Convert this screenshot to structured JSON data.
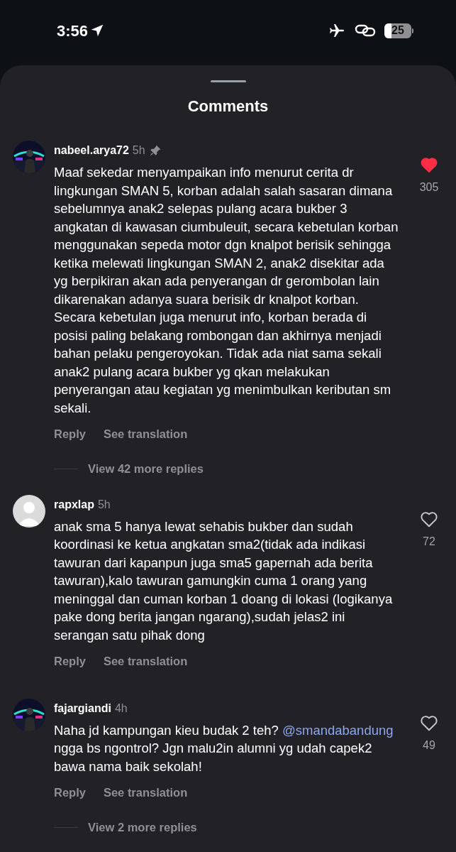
{
  "status_bar": {
    "time": "3:56",
    "battery_text": "25"
  },
  "sheet": {
    "title": "Comments"
  },
  "comments": [
    {
      "username": "nabeel.arya72",
      "age": "5h",
      "pinned": true,
      "liked": true,
      "likes": "305",
      "body": [
        {
          "kind": "text",
          "text": "Maaf sekedar menyampaikan info menurut cerita dr lingkungan SMAN 5, korban adalah salah sasaran dimana sebelumnya anak2 selepas pulang acara bukber 3 angkatan di kawasan ciumbuleuit, secara kebetulan korban menggunakan sepeda motor dgn knalpot berisik sehingga ketika melewati lingkungan SMAN 2, anak2 disekitar ada yg berpikiran akan ada penyerangan dr gerombolan lain dikarenakan adanya suara berisik dr knalpot korban. Secara kebetulan juga menurut info, korban berada di posisi paling belakang rombongan dan akhirnya menjadi bahan pelaku pengeroyokan. Tidak ada niat sama sekali anak2 pulang acara bukber yg qkan melakukan penyerangan atau kegiatan yg menimbulkan keributan sm sekali."
        }
      ],
      "reply": "Reply",
      "translate": "See translation",
      "more_replies": "View 42 more replies"
    },
    {
      "avatar": {
        "kind": "default"
      },
      "username": "rapxlap",
      "age": "5h",
      "pinned": false,
      "liked": false,
      "likes": "72",
      "body": [
        {
          "kind": "text",
          "text": "anak sma 5 hanya lewat sehabis bukber dan sudah koordinasi ke ketua angkatan sma2(tidak ada indikasi tawuran dari kapanpun juga sma5 gapernah ada berita tawuran),kalo tawuran gamungkin cuma 1 orang yang meninggal dan cuman korban 1 doang di lokasi (logikanya pake dong berita jangan ngarang),sudah jelas2 ini serangan satu pihak dong"
        }
      ],
      "reply": "Reply",
      "translate": "See translation"
    },
    {
      "username": "fajargiandi",
      "age": "4h",
      "pinned": false,
      "liked": false,
      "likes": "49",
      "body": [
        {
          "kind": "text",
          "text": "Naha jd kampungan kieu budak 2 teh? "
        },
        {
          "kind": "mention",
          "text": "@smandabandung"
        },
        {
          "kind": "text",
          "text": " ngga bs ngontrol? Jgn malu2in alumni yg udah capek2 bawa nama baik sekolah!"
        }
      ],
      "reply": "Reply",
      "translate": "See translation",
      "more_replies": "View 2 more replies"
    }
  ]
}
